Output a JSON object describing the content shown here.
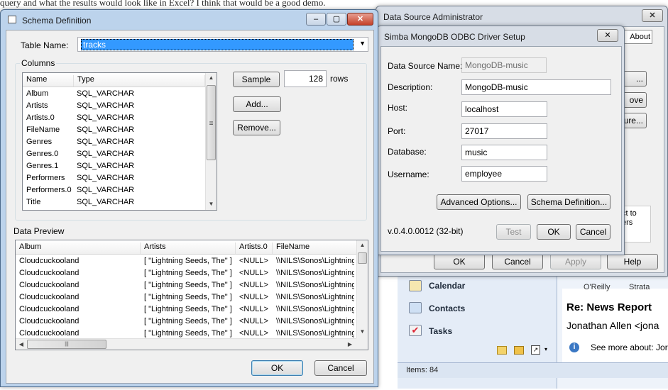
{
  "background": {
    "top_text": "query and what the results would look like in Excel? I think that would be a good demo.",
    "bottom_right_fragment": "\\\\NILS\\So",
    "outlook": {
      "nav": {
        "calendar": "Calendar",
        "contacts": "Contacts",
        "tasks": "Tasks"
      },
      "status": "Items: 84",
      "message_title": "Re: News Report",
      "message_from": "Jonathan Allen <jona",
      "see_more": "See more about: Jor",
      "oreilly_fragment": "O'Reilly",
      "strata_fragment": "Strata"
    }
  },
  "dsa": {
    "title": "Data Source Administrator",
    "about_tab": "About",
    "side_frag_1": "ove",
    "side_frag_2": "ure...",
    "side_frag_3": "...",
    "right_frag_1": "ct to",
    "right_frag_2": "ers",
    "ok": "OK",
    "cancel": "Cancel",
    "apply": "Apply",
    "help": "Help"
  },
  "simba": {
    "title": "Simba MongoDB ODBC Driver Setup",
    "fields": {
      "dsn_label": "Data Source Name:",
      "dsn_value": "MongoDB-music",
      "desc_label": "Description:",
      "desc_value": "MongoDB-music",
      "host_label": "Host:",
      "host_value": "localhost",
      "port_label": "Port:",
      "port_value": "27017",
      "db_label": "Database:",
      "db_value": "music",
      "user_label": "Username:",
      "user_value": "employee"
    },
    "advanced_button": "Advanced Options...",
    "schema_button": "Schema Definition...",
    "version": "v.0.4.0.0012 (32-bit)",
    "test_button": "Test",
    "ok_button": "OK",
    "cancel_button": "Cancel"
  },
  "schema": {
    "title": "Schema Definition",
    "table_label": "Table Name:",
    "table_value": "tracks",
    "columns_group": "Columns",
    "col_headers": [
      "Name",
      "Type"
    ],
    "columns": [
      {
        "name": "Album",
        "type": "SQL_VARCHAR"
      },
      {
        "name": "Artists",
        "type": "SQL_VARCHAR"
      },
      {
        "name": "Artists.0",
        "type": "SQL_VARCHAR"
      },
      {
        "name": "FileName",
        "type": "SQL_VARCHAR"
      },
      {
        "name": "Genres",
        "type": "SQL_VARCHAR"
      },
      {
        "name": "Genres.0",
        "type": "SQL_VARCHAR"
      },
      {
        "name": "Genres.1",
        "type": "SQL_VARCHAR"
      },
      {
        "name": "Performers",
        "type": "SQL_VARCHAR"
      },
      {
        "name": "Performers.0",
        "type": "SQL_VARCHAR"
      },
      {
        "name": "Title",
        "type": "SQL_VARCHAR"
      }
    ],
    "sample_button": "Sample",
    "sample_rows": "128",
    "rows_label": "rows",
    "add_button": "Add...",
    "remove_button": "Remove...",
    "preview_label": "Data Preview",
    "preview_headers": [
      "Album",
      "Artists",
      "Artists.0",
      "FileName"
    ],
    "preview_rows": [
      [
        "Cloudcuckooland",
        "[ \"Lightning Seeds, The\" ]",
        "<NULL>",
        "\\\\NILS\\Sonos\\Lightning"
      ],
      [
        "Cloudcuckooland",
        "[ \"Lightning Seeds, The\" ]",
        "<NULL>",
        "\\\\NILS\\Sonos\\Lightning"
      ],
      [
        "Cloudcuckooland",
        "[ \"Lightning Seeds, The\" ]",
        "<NULL>",
        "\\\\NILS\\Sonos\\Lightning"
      ],
      [
        "Cloudcuckooland",
        "[ \"Lightning Seeds, The\" ]",
        "<NULL>",
        "\\\\NILS\\Sonos\\Lightning"
      ],
      [
        "Cloudcuckooland",
        "[ \"Lightning Seeds, The\" ]",
        "<NULL>",
        "\\\\NILS\\Sonos\\Lightning"
      ],
      [
        "Cloudcuckooland",
        "[ \"Lightning Seeds, The\" ]",
        "<NULL>",
        "\\\\NILS\\Sonos\\Lightning"
      ],
      [
        "Cloudcuckooland",
        "[ \"Lightning Seeds, The\" ]",
        "<NULL>",
        "\\\\NILS\\Sonos\\Lightning"
      ]
    ],
    "ok_button": "OK",
    "cancel_button": "Cancel"
  }
}
